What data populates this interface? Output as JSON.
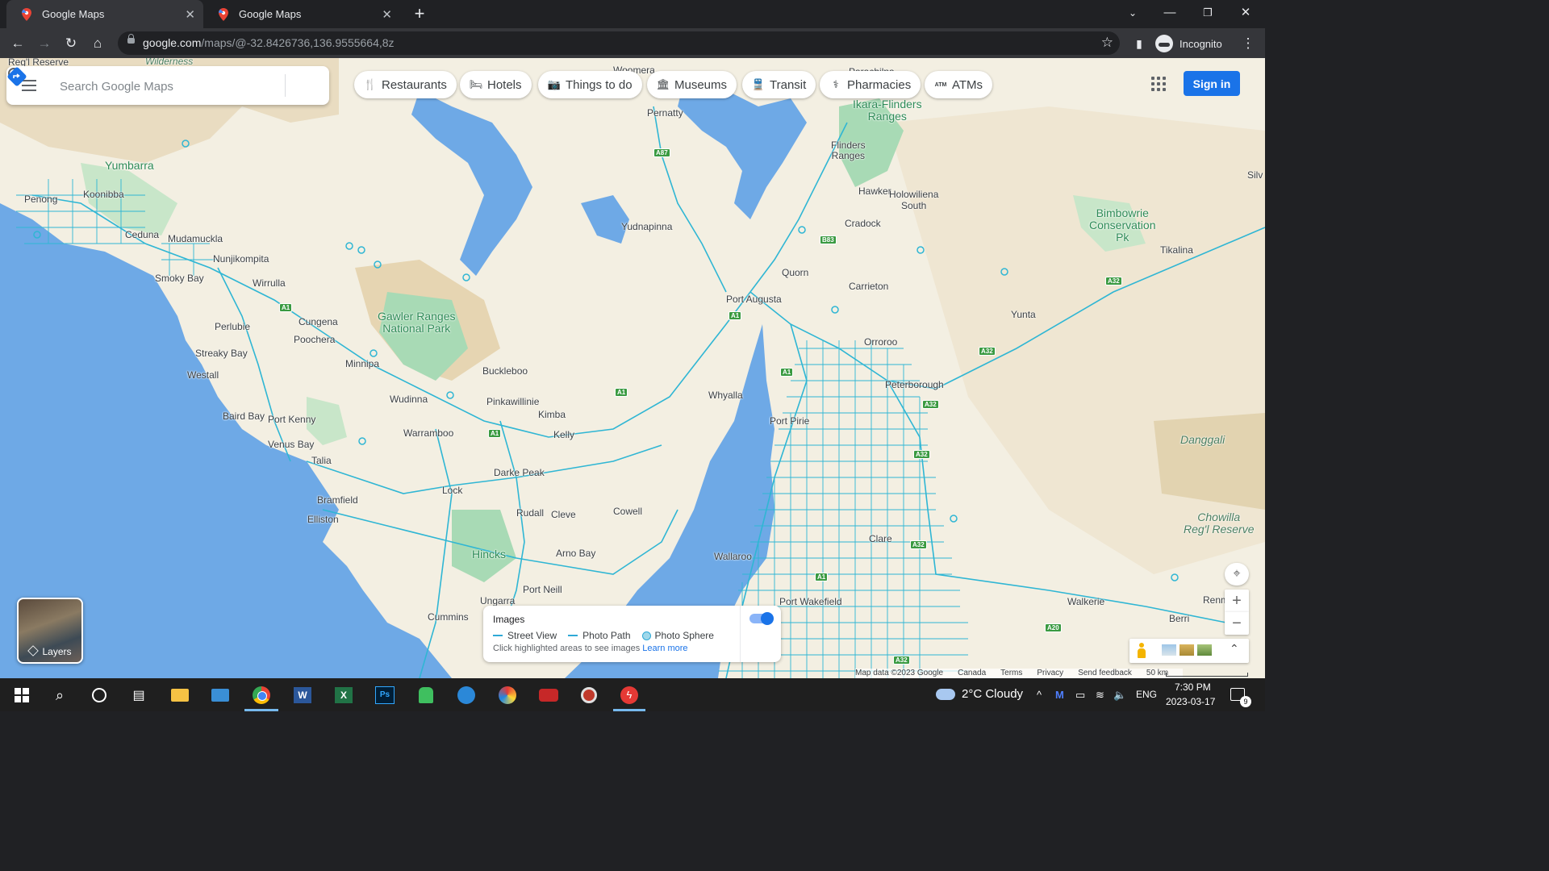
{
  "browser": {
    "tabs": [
      {
        "title": "Google Maps",
        "active": true
      },
      {
        "title": "Google Maps",
        "active": false
      }
    ],
    "url_host": "google.com",
    "url_path": "/maps/@-32.8426736,136.9555664,8z",
    "profile_label": "Incognito"
  },
  "maps": {
    "search_placeholder": "Search Google Maps",
    "chips": [
      "Restaurants",
      "Hotels",
      "Things to do",
      "Museums",
      "Transit",
      "Pharmacies",
      "ATMs"
    ],
    "sign_in_label": "Sign in",
    "layers_label": "Layers",
    "images_card": {
      "title": "Images",
      "street_view": "Street View",
      "photo_path": "Photo Path",
      "photo_sphere": "Photo Sphere",
      "hint": "Click highlighted areas to see images",
      "learn_more": "Learn more",
      "toggle_on": true
    },
    "attribution": {
      "map_data": "Map data ©2023 Google",
      "country": "Canada",
      "terms": "Terms",
      "privacy": "Privacy",
      "feedback": "Send feedback",
      "scale": "50 km"
    },
    "places": {
      "regl_reserve": "Reg'l Reserve",
      "wilderness": "Wilderness",
      "woomera": "Woomera",
      "parachilna": "Parachilna",
      "yumbarra": "Yumbarra",
      "penong": "Penong",
      "koonibba": "Koonibba",
      "ceduna": "Ceduna",
      "mudamuckla": "Mudamuckla",
      "nunjikompita": "Nunjikompita",
      "smoky_bay": "Smoky Bay",
      "wirrulla": "Wirrulla",
      "perlubie": "Perlubie",
      "cungena": "Cungena",
      "poochera": "Poochera",
      "streaky_bay": "Streaky Bay",
      "westall": "Westall",
      "minnipa": "Minnipa",
      "wudinna": "Wudinna",
      "baird_bay": "Baird Bay",
      "port_kenny": "Port Kenny",
      "venus_bay": "Venus Bay",
      "talia": "Talia",
      "warramboo": "Warramboo",
      "bramfield": "Bramfield",
      "elliston": "Elliston",
      "lock": "Lock",
      "darke_peak": "Darke Peak",
      "rudall": "Rudall",
      "cleve": "Cleve",
      "cowell": "Cowell",
      "hincks": "Hincks",
      "arno_bay": "Arno Bay",
      "port_neill": "Port Neill",
      "ungarra": "Ungarra",
      "cummins": "Cummins",
      "gawler_ranges": "Gawler Ranges\nNational Park",
      "buckleboo": "Buckleboo",
      "pinkawillinie": "Pinkawillinie",
      "kimba": "Kimba",
      "kelly": "Kelly",
      "pernatty": "Pernatty",
      "yudnapinna": "Yudnapinna",
      "port_augusta": "Port Augusta",
      "whyalla": "Whyalla",
      "port_pirie": "Port Pirie",
      "wallaroo": "Wallaroo",
      "port_wakefield": "Port Wakefield",
      "ikara": "Ikara-Flinders\nRanges",
      "flinders_ranges": "Flinders\nRanges",
      "hawker": "Hawker",
      "holowiliena": "Holowiliena\nSouth",
      "cradock": "Cradock",
      "quorn": "Quorn",
      "carrieton": "Carrieton",
      "orroroo": "Orroroo",
      "peterborough": "Peterborough",
      "yunta": "Yunta",
      "clare": "Clare",
      "bimbowrie": "Bimbowrie\nConservation\nPk",
      "tikalina": "Tikalina",
      "silv": "Silv",
      "danggali": "Danggali",
      "chowilla": "Chowilla\nReg'l Reserve",
      "walkerie": "Walkerie",
      "renmark": "Renmark",
      "berri": "Berri"
    },
    "shields": {
      "a87": "A87",
      "b83": "B83",
      "a1_a": "A1",
      "a1_b": "A1",
      "a1_c": "A1",
      "a1_d": "A1",
      "a1_e": "A1",
      "a32_a": "A32",
      "a32_b": "A32",
      "a32_c": "A32",
      "a32_d": "A32",
      "a32_e": "A32",
      "a20": "A20",
      "a32_f": "A32",
      "a1_f": "A1"
    }
  },
  "taskbar": {
    "weather": "2°C  Cloudy",
    "lang": "ENG",
    "time": "7:30 PM",
    "date": "2023-03-17",
    "notifications": "9"
  },
  "colors": {
    "land": "#f3efe2",
    "water": "#6ea9e6",
    "park": "#a8dab5",
    "roads": "#2fb6d4",
    "accent": "#1a73e8"
  }
}
